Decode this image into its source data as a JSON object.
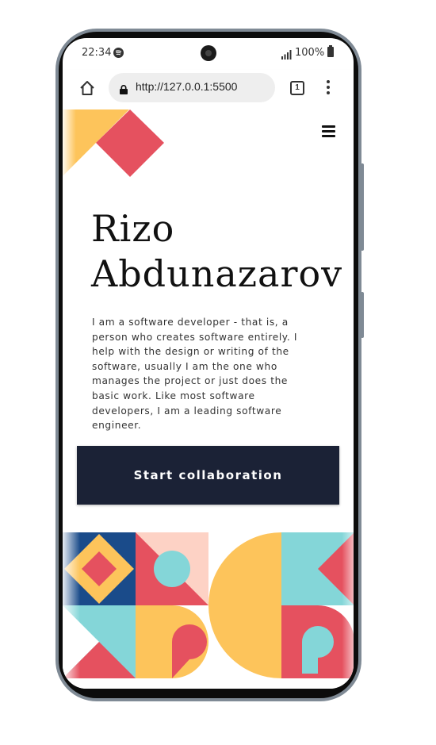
{
  "status_bar": {
    "time": "22:34",
    "battery": "100%"
  },
  "browser": {
    "url": "http://127.0.0.1:5500",
    "tab_count": "1"
  },
  "page": {
    "title_line1": "Rizo",
    "title_line2": "Abdunazarov",
    "bio": "I am a software developer - that is, a person who creates software entirely. I help with the design or writing of the software, usually I am the one who manages the project or just does the basic work. Like most software developers, I am a leading software engineer.",
    "cta_label": "Start collaboration"
  },
  "colors": {
    "yellow": "#fdc45b",
    "red": "#e5515f",
    "navy": "#1a4b8a",
    "teal": "#84d6d8",
    "peach": "#fdd2c5",
    "button_bg": "#1b2236"
  },
  "icons": {
    "home": "home-icon",
    "lock": "lock-icon",
    "tabs": "tabs-icon",
    "menu": "more-vertical-icon",
    "hamburger": "hamburger-menu-icon",
    "spotify": "spotify-icon",
    "signal": "signal-icon",
    "battery": "battery-icon"
  }
}
